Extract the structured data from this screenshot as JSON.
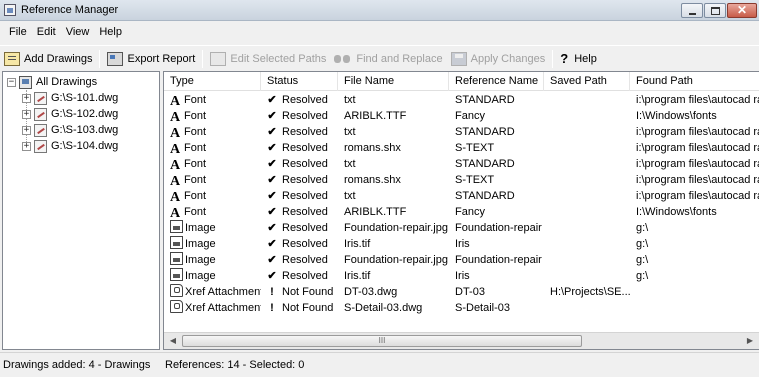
{
  "window": {
    "title": "Reference Manager",
    "controls": {
      "minimize": "minimize",
      "maximize": "maximize",
      "close": "✕"
    }
  },
  "menu": [
    "File",
    "Edit",
    "View",
    "Help"
  ],
  "toolbar": {
    "add_drawings": "Add Drawings",
    "export_report": "Export Report",
    "edit_selected_paths": "Edit Selected Paths",
    "find_and_replace": "Find and Replace",
    "apply_changes": "Apply Changes",
    "help": "Help",
    "help_glyph": "?"
  },
  "tree": {
    "root": {
      "label": "All Drawings",
      "expander": "−",
      "icon": "drawings-icon"
    },
    "children": [
      {
        "label": "G:\\S-101.dwg",
        "expander": "+",
        "icon": "dwg-file-icon"
      },
      {
        "label": "G:\\S-102.dwg",
        "expander": "+",
        "icon": "dwg-file-icon"
      },
      {
        "label": "G:\\S-103.dwg",
        "expander": "+",
        "icon": "dwg-file-icon"
      },
      {
        "label": "G:\\S-104.dwg",
        "expander": "+",
        "icon": "dwg-file-icon"
      }
    ]
  },
  "list": {
    "columns": [
      "Type",
      "Status",
      "File Name",
      "Reference Name",
      "Saved Path",
      "Found Path"
    ],
    "rows": [
      {
        "type": "Font",
        "type_icon": "font-icon",
        "type_glyph": "A",
        "status": "Resolved",
        "status_glyph": "✔",
        "file_name": "txt",
        "reference_name": "STANDARD",
        "saved_path": "",
        "found_path": "i:\\program files\\autocad ra"
      },
      {
        "type": "Font",
        "type_icon": "font-icon",
        "type_glyph": "A",
        "status": "Resolved",
        "status_glyph": "✔",
        "file_name": "ARIBLK.TTF",
        "reference_name": "Fancy",
        "saved_path": "",
        "found_path": "I:\\Windows\\fonts"
      },
      {
        "type": "Font",
        "type_icon": "font-icon",
        "type_glyph": "A",
        "status": "Resolved",
        "status_glyph": "✔",
        "file_name": "txt",
        "reference_name": "STANDARD",
        "saved_path": "",
        "found_path": "i:\\program files\\autocad ra"
      },
      {
        "type": "Font",
        "type_icon": "font-icon",
        "type_glyph": "A",
        "status": "Resolved",
        "status_glyph": "✔",
        "file_name": "romans.shx",
        "reference_name": "S-TEXT",
        "saved_path": "",
        "found_path": "i:\\program files\\autocad ra"
      },
      {
        "type": "Font",
        "type_icon": "font-icon",
        "type_glyph": "A",
        "status": "Resolved",
        "status_glyph": "✔",
        "file_name": "txt",
        "reference_name": "STANDARD",
        "saved_path": "",
        "found_path": "i:\\program files\\autocad ra"
      },
      {
        "type": "Font",
        "type_icon": "font-icon",
        "type_glyph": "A",
        "status": "Resolved",
        "status_glyph": "✔",
        "file_name": "romans.shx",
        "reference_name": "S-TEXT",
        "saved_path": "",
        "found_path": "i:\\program files\\autocad ra"
      },
      {
        "type": "Font",
        "type_icon": "font-icon",
        "type_glyph": "A",
        "status": "Resolved",
        "status_glyph": "✔",
        "file_name": "txt",
        "reference_name": "STANDARD",
        "saved_path": "",
        "found_path": "i:\\program files\\autocad ra"
      },
      {
        "type": "Font",
        "type_icon": "font-icon",
        "type_glyph": "A",
        "status": "Resolved",
        "status_glyph": "✔",
        "file_name": "ARIBLK.TTF",
        "reference_name": "Fancy",
        "saved_path": "",
        "found_path": "I:\\Windows\\fonts"
      },
      {
        "type": "Image",
        "type_icon": "image-icon",
        "type_glyph": "",
        "status": "Resolved",
        "status_glyph": "✔",
        "file_name": "Foundation-repair.jpg",
        "reference_name": "Foundation-repair",
        "saved_path": "",
        "found_path": "g:\\"
      },
      {
        "type": "Image",
        "type_icon": "image-icon",
        "type_glyph": "",
        "status": "Resolved",
        "status_glyph": "✔",
        "file_name": "Iris.tif",
        "reference_name": "Iris",
        "saved_path": "",
        "found_path": "g:\\"
      },
      {
        "type": "Image",
        "type_icon": "image-icon",
        "type_glyph": "",
        "status": "Resolved",
        "status_glyph": "✔",
        "file_name": "Foundation-repair.jpg",
        "reference_name": "Foundation-repair",
        "saved_path": "",
        "found_path": "g:\\"
      },
      {
        "type": "Image",
        "type_icon": "image-icon",
        "type_glyph": "",
        "status": "Resolved",
        "status_glyph": "✔",
        "file_name": "Iris.tif",
        "reference_name": "Iris",
        "saved_path": "",
        "found_path": "g:\\"
      },
      {
        "type": "Xref Attachment",
        "type_icon": "xref-icon",
        "type_glyph": "",
        "status": "Not Found",
        "status_glyph": "!",
        "file_name": "DT-03.dwg",
        "reference_name": "DT-03",
        "saved_path": "H:\\Projects\\SE...",
        "found_path": ""
      },
      {
        "type": "Xref Attachment",
        "type_icon": "xref-icon",
        "type_glyph": "",
        "status": "Not Found",
        "status_glyph": "!",
        "file_name": "S-Detail-03.dwg",
        "reference_name": "S-Detail-03",
        "saved_path": "",
        "found_path": ""
      }
    ],
    "scrollbar": {
      "left_arrow": "◀",
      "right_arrow": "▶",
      "grip": "III"
    }
  },
  "statusbar": {
    "left": "Drawings added: 4 - Drawings",
    "right": "References: 14 - Selected: 0"
  }
}
